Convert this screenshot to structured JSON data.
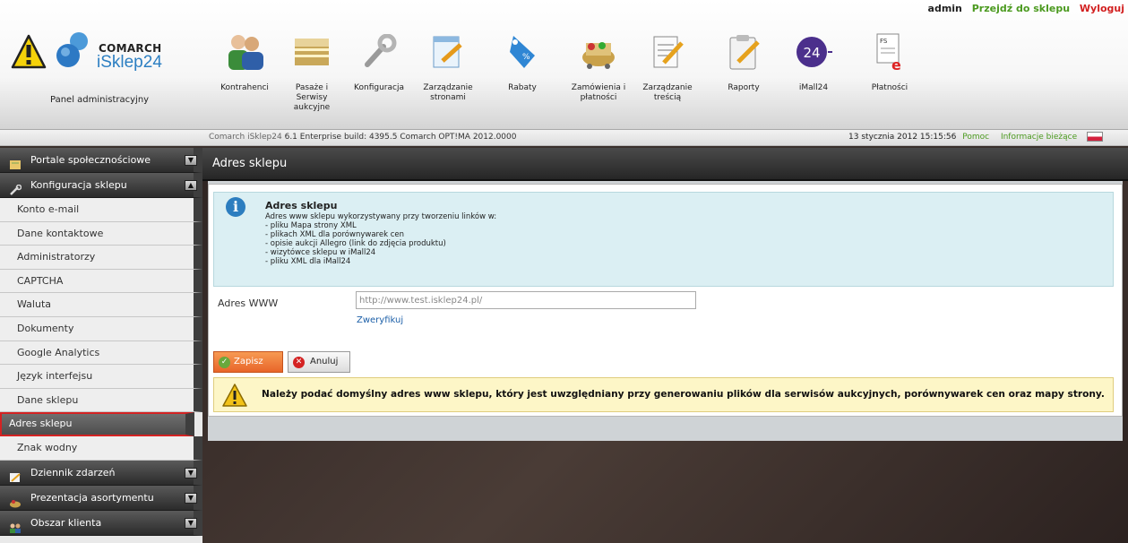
{
  "top_links": {
    "user": "admin",
    "go_to_shop": "Przejdź do sklepu",
    "logout": "Wyloguj"
  },
  "logo": {
    "company": "COMARCH",
    "product": "iSklep24",
    "panel": "Panel administracyjny"
  },
  "nav": [
    {
      "label": "Kontrahenci",
      "icon": "users-icon"
    },
    {
      "label": "Pasaże i Serwisy aukcyjne",
      "icon": "auction-folder-icon"
    },
    {
      "label": "Konfiguracja",
      "icon": "wrench-icon"
    },
    {
      "label": "Zarządzanie stronami",
      "icon": "page-edit-icon"
    },
    {
      "label": "Rabaty",
      "icon": "discount-tag-icon"
    },
    {
      "label": "Zamówienia i płatności",
      "icon": "shopping-cart-icon"
    },
    {
      "label": "Zarządzanie treścią",
      "icon": "content-edit-icon"
    },
    {
      "label": "Raporty",
      "icon": "clipboard-report-icon"
    },
    {
      "label": "iMall24",
      "icon": "imall24-icon",
      "badge": "24"
    },
    {
      "label": "Płatności",
      "icon": "e-invoice-icon",
      "badge": "FS"
    }
  ],
  "infobar": {
    "build_prefix": "Comarch iSklep24",
    "build_version": "6.1",
    "build_rest": "Enterprise build: 4395.5 Comarch OPT!MA 2012.0000",
    "datetime": "13 stycznia 2012 15:15:56",
    "help": "Pomoc",
    "news": "Informacje bieżące"
  },
  "sidebar": {
    "section_social": "Portale społecznościowe",
    "section_config": "Konfiguracja sklepu",
    "items": [
      "Konto e-mail",
      "Dane kontaktowe",
      "Administratorzy",
      "CAPTCHA",
      "Waluta",
      "Dokumenty",
      "Google Analytics",
      "Język interfejsu",
      "Dane sklepu",
      "Adres sklepu",
      "Znak wodny"
    ],
    "section_log": "Dziennik zdarzeń",
    "section_assort": "Prezentacja asortymentu",
    "section_client": "Obszar klienta"
  },
  "content": {
    "header": "Adres sklepu",
    "info_title": "Adres sklepu",
    "info_lines": [
      "Adres www sklepu wykorzystywany przy tworzeniu linków w:",
      "- pliku Mapa strony XML",
      "- plikach XML dla porównywarek cen",
      "- opisie aukcji Allegro (link do zdjęcia produktu)",
      "- wizytówce sklepu w iMall24",
      "- pliku XML dla iMall24"
    ],
    "www_label": "Adres WWW",
    "www_value": "http://www.test.isklep24.pl/",
    "verify": "Zweryfikuj",
    "save": "Zapisz",
    "cancel": "Anuluj",
    "warning": "Należy podać domyślny adres www sklepu, który jest uwzględniany przy generowaniu plików dla serwisów aukcyjnych, porównywarek cen oraz mapy strony."
  },
  "colors": {
    "accent_green": "#4b9a1f",
    "logout_red": "#d21f1f",
    "link_blue": "#1c5fa8",
    "save_orange": "#e8652a",
    "active_border": "#d42222"
  }
}
